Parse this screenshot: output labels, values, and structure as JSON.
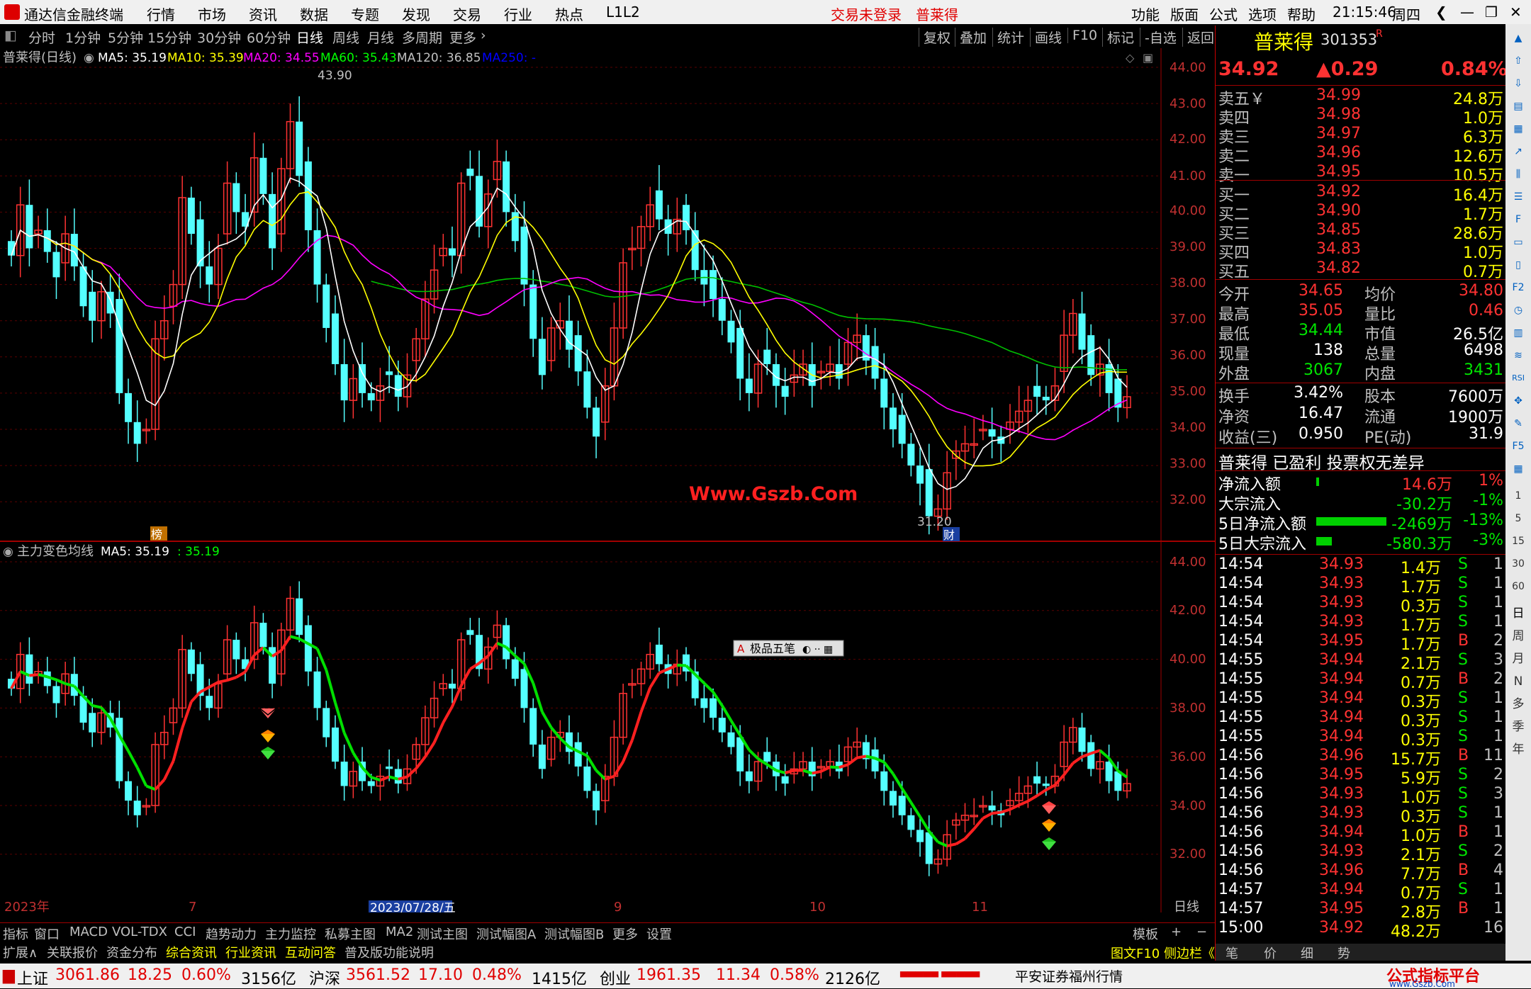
{
  "app": {
    "title": "通达信金融终端",
    "menus": [
      "行情",
      "市场",
      "资讯",
      "数据",
      "专题",
      "发现",
      "交易",
      "行业",
      "热点",
      "L1L2"
    ],
    "login": "交易未登录",
    "stock_link": "普莱得",
    "right_menus": [
      "功能",
      "版面",
      "公式",
      "选项",
      "帮助"
    ],
    "time": "21:15:46",
    "weekday": "周四"
  },
  "toolbar": {
    "periods": [
      "分时",
      "1分钟",
      "5分钟",
      "15分钟",
      "30分钟",
      "60分钟",
      "日线",
      "周线",
      "月线",
      "多周期",
      "更多"
    ],
    "active_period": "日线",
    "actions": [
      "复权",
      "叠加",
      "统计",
      "画线",
      "F10",
      "标记",
      "-自选",
      "返回"
    ]
  },
  "main_chart": {
    "title": "普莱得(日线)",
    "ma_labels": [
      {
        "t": "MA5: 35.19",
        "c": "#ffffff"
      },
      {
        "t": "MA10: 35.39",
        "c": "#ffff00"
      },
      {
        "t": "MA20: 34.55",
        "c": "#ff00ff"
      },
      {
        "t": "MA60: 35.43",
        "c": "#00ff00"
      },
      {
        "t": "MA120: 36.85",
        "c": "#c0c0c0"
      },
      {
        "t": "MA250: -",
        "c": "#0000ff"
      }
    ],
    "y_ticks": [
      "44.00",
      "43.00",
      "42.00",
      "41.00",
      "40.00",
      "39.00",
      "38.00",
      "37.00",
      "36.00",
      "35.00",
      "34.00",
      "33.00",
      "32.00"
    ],
    "high_label": "43.90",
    "low_label": "31.20",
    "watermark": "Www.Gszb.Com",
    "tag_bang": "榜",
    "tag_cai": "财"
  },
  "sub_chart": {
    "title": "主力变色均线",
    "ma5": "MA5: 35.19",
    "value": ": 35.19",
    "y_ticks": [
      "44.00",
      "42.00",
      "40.00",
      "38.00",
      "36.00",
      "34.00",
      "32.00"
    ],
    "popup": "极品五笔"
  },
  "x_axis": {
    "labels": [
      "2023年",
      "7",
      "2023/07/28/五",
      "9",
      "10",
      "11"
    ],
    "period": "日线"
  },
  "tabs1": [
    "指标",
    "窗口",
    "MACD",
    "VOL-TDX",
    "CCI",
    "趋势动力",
    "主力监控",
    "私募主图",
    "MA2",
    "测试主图",
    "测试幅图A",
    "测试幅图B",
    "更多",
    "设置"
  ],
  "tabs1_right": [
    "模板",
    "+",
    "−"
  ],
  "tabs2": [
    "扩展∧",
    "关联报价",
    "资金分布",
    "综合资讯",
    "行业资讯",
    "互动问答",
    "普及版功能说明"
  ],
  "panel": {
    "name": "普莱得",
    "code": "301353",
    "flag": "R",
    "price": "34.92",
    "change": "▲0.29",
    "pct": "0.84%",
    "asks": [
      [
        "卖五￥",
        "34.99",
        "24.8万"
      ],
      [
        "卖四",
        "34.98",
        "1.0万"
      ],
      [
        "卖三",
        "34.97",
        "6.3万"
      ],
      [
        "卖二",
        "34.96",
        "12.6万"
      ],
      [
        "卖一",
        "34.95",
        "10.5万"
      ]
    ],
    "bids": [
      [
        "买一",
        "34.92",
        "16.4万"
      ],
      [
        "买二",
        "34.90",
        "1.7万"
      ],
      [
        "买三",
        "34.85",
        "28.6万"
      ],
      [
        "买四",
        "34.83",
        "1.0万"
      ],
      [
        "买五",
        "34.82",
        "0.7万"
      ]
    ],
    "stats": [
      [
        "今开",
        "34.65",
        "均价",
        "34.80"
      ],
      [
        "最高",
        "35.05",
        "量比",
        "0.46"
      ],
      [
        "最低",
        "34.44",
        "市值",
        "26.5亿"
      ],
      [
        "现量",
        "138",
        "总量",
        "6498"
      ],
      [
        "外盘",
        "3067",
        "内盘",
        "3431"
      ]
    ],
    "stats2": [
      [
        "换手",
        "3.42%",
        "股本",
        "7600万"
      ],
      [
        "净资",
        "16.47",
        "流通",
        "1900万"
      ],
      [
        "收益(三)",
        "0.950",
        "PE(动)",
        "31.9"
      ]
    ],
    "notice": "普莱得 已盈利 投票权无差异",
    "flows": [
      [
        "净流入额",
        "14.6万",
        "1%"
      ],
      [
        "大宗流入",
        "-30.2万",
        "-1%"
      ],
      [
        "5日净流入额",
        "-2469万",
        "-13%"
      ],
      [
        "5日大宗流入",
        "-580.3万",
        "-3%"
      ]
    ],
    "flow_fill": [
      0.04,
      0,
      0.9,
      0.2
    ],
    "ticks": [
      [
        "14:54",
        "34.93",
        "1.4万",
        "S",
        "1"
      ],
      [
        "14:54",
        "34.93",
        "1.7万",
        "S",
        "1"
      ],
      [
        "14:54",
        "34.93",
        "0.3万",
        "S",
        "1"
      ],
      [
        "14:54",
        "34.93",
        "1.7万",
        "S",
        "1"
      ],
      [
        "14:54",
        "34.95",
        "1.7万",
        "B",
        "2"
      ],
      [
        "14:55",
        "34.94",
        "2.1万",
        "S",
        "3"
      ],
      [
        "14:55",
        "34.94",
        "0.7万",
        "B",
        "2"
      ],
      [
        "14:55",
        "34.94",
        "0.3万",
        "S",
        "1"
      ],
      [
        "14:55",
        "34.94",
        "0.3万",
        "S",
        "1"
      ],
      [
        "14:55",
        "34.94",
        "0.3万",
        "S",
        "1"
      ],
      [
        "14:56",
        "34.96",
        "15.7万",
        "B",
        "11"
      ],
      [
        "14:56",
        "34.95",
        "5.9万",
        "S",
        "2"
      ],
      [
        "14:56",
        "34.93",
        "1.0万",
        "S",
        "3"
      ],
      [
        "14:56",
        "34.93",
        "0.3万",
        "S",
        "1"
      ],
      [
        "14:56",
        "34.94",
        "1.0万",
        "B",
        "1"
      ],
      [
        "14:56",
        "34.93",
        "2.1万",
        "S",
        "2"
      ],
      [
        "14:56",
        "34.96",
        "7.7万",
        "B",
        "4"
      ],
      [
        "14:57",
        "34.94",
        "0.7万",
        "S",
        "1"
      ],
      [
        "14:57",
        "34.95",
        "2.8万",
        "B",
        "1"
      ],
      [
        "15:00",
        "34.92",
        "48.2万",
        "",
        "16"
      ]
    ],
    "bottom_label": "图文F10 侧边栏《",
    "btabs": [
      "笔",
      "价",
      "细",
      "势"
    ]
  },
  "sidebar": {
    "items": [
      "日",
      "周",
      "月",
      "N",
      "多",
      "季",
      "年"
    ]
  },
  "status": {
    "indices": [
      {
        "name": "上证",
        "val": "3061.86",
        "chg": "18.25",
        "pct": "0.60%",
        "amt": "3156亿"
      },
      {
        "name": "沪深",
        "val": "3561.52",
        "chg": "17.10",
        "pct": "0.48%",
        "amt": "1415亿"
      },
      {
        "name": "创业",
        "val": "1961.35",
        "chg": "11.34",
        "pct": "0.58%",
        "amt": "2126亿"
      }
    ],
    "broker": "平安证券福州行情",
    "logo": "公式指标平台",
    "logo_url": "www.Gszb.Com"
  }
}
